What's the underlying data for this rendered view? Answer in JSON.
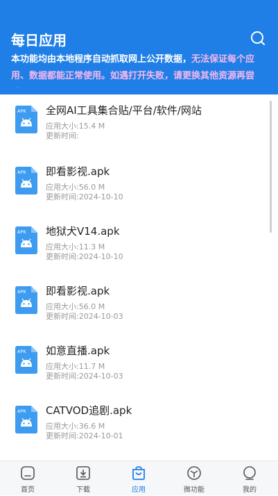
{
  "header": {
    "title": "每日应用",
    "notice_plain": "本功能均由本地程序自动抓取网上公开数据，",
    "notice_highlight": "无法保证每个应用、数据都能正常使用。如遇打开失败，请更换其他资源再尝试。"
  },
  "list": [
    {
      "name": "全网AI工具集合贴/平台/软件/网站",
      "size": "应用大小:15.4 M",
      "updated": "更新时间:"
    },
    {
      "name": "即看影视.apk",
      "size": "应用大小:56.0 M",
      "updated": "更新时间:2024-10-10"
    },
    {
      "name": "地狱犬V14.apk",
      "size": "应用大小:11.3 M",
      "updated": "更新时间:2024-10-10"
    },
    {
      "name": "即看影视.apk",
      "size": "应用大小:56.0 M",
      "updated": "更新时间:2024-10-03"
    },
    {
      "name": "如意直播.apk",
      "size": "应用大小:11.7 M",
      "updated": "更新时间:2024-10-03"
    },
    {
      "name": "CATVOD追剧.apk",
      "size": "应用大小:36.6 M",
      "updated": "更新时间:2024-10-01"
    }
  ],
  "apk_badge": "APK",
  "tabs": [
    {
      "label": "首页",
      "icon": "home-icon"
    },
    {
      "label": "下载",
      "icon": "download-icon"
    },
    {
      "label": "应用",
      "icon": "apps-icon",
      "active": true
    },
    {
      "label": "微功能",
      "icon": "cube-icon"
    },
    {
      "label": "我的",
      "icon": "profile-icon"
    }
  ],
  "colors": {
    "accent": "#1f7fe6",
    "highlight": "#f7b8ee",
    "android": "#3d9bf0"
  }
}
